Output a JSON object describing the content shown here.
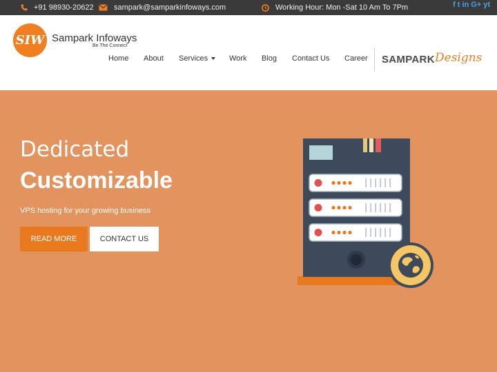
{
  "topbar": {
    "phone": "+91 98930-20622",
    "email": "sampark@samparkinfoways.com",
    "hours": "Working Hour: Mon -Sat 10 Am To 7Pm",
    "social": [
      "f",
      "t",
      "in",
      "G+",
      "yt"
    ]
  },
  "brand": {
    "logo_text": "SIW",
    "name": "Sampark Infoways",
    "tagline": "Be The Connect"
  },
  "nav": {
    "items": [
      "Home",
      "About",
      "Services",
      "Work",
      "Blog",
      "Contact Us",
      "Career"
    ]
  },
  "partner": {
    "part1": "SAMPARK",
    "part2": "Designs"
  },
  "hero": {
    "title_line1": "Dedicated",
    "title_line2": "Customizable",
    "subtitle": "VPS hosting for your growing business",
    "btn_primary": "READ MORE",
    "btn_secondary": "CONTACT US"
  },
  "colors": {
    "topbar_bg": "#3a3a3a",
    "accent": "#f07f22",
    "hero_bg": "#e3935d",
    "server_body": "#3d4a5c"
  },
  "icons": {
    "phone": "phone-icon",
    "email": "envelope-icon",
    "hours": "clock-icon",
    "globe": "globe-icon"
  }
}
